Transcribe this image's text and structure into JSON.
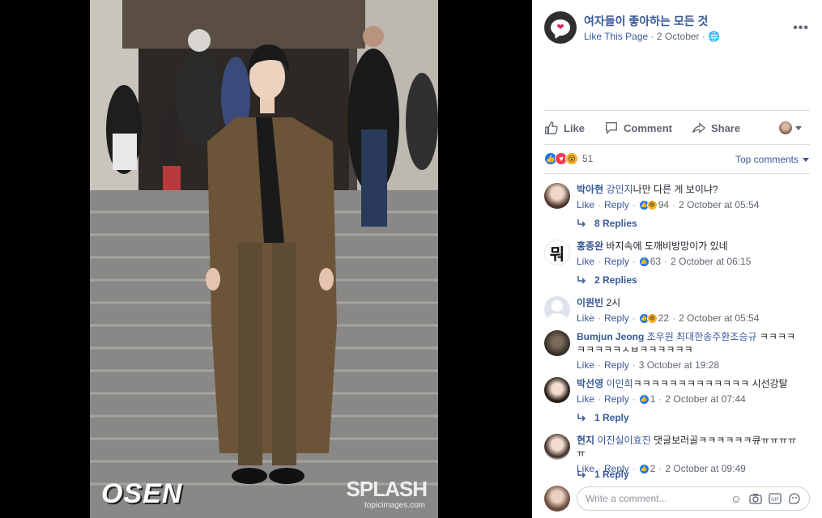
{
  "post": {
    "page_name": "여자들이 좋아하는 모든 것",
    "like_page": "Like This Page",
    "date": "2 October",
    "more": "•••"
  },
  "photo": {
    "watermark_left": "OSEN",
    "watermark_right": "SPLASH",
    "watermark_right_sub": "topicimages.com"
  },
  "actions": {
    "like": "Like",
    "comment": "Comment",
    "share": "Share"
  },
  "reactions": {
    "count": "51",
    "sort": "Top comments"
  },
  "comments": [
    {
      "name": "박아현",
      "mention": "강민지",
      "text": "나만 다른 게 보이냐?",
      "like": "Like",
      "reply": "Reply",
      "reaction_count": "94",
      "time": "2 October at 05:54",
      "replies": "8 Replies"
    },
    {
      "name": "홍종완",
      "mention": "",
      "text": "바지속에 도깨비방망이가 있네",
      "like": "Like",
      "reply": "Reply",
      "reaction_count": "63",
      "time": "2 October at 06:15",
      "replies": "2 Replies"
    },
    {
      "name": "이원빈",
      "mention": "",
      "text": "2시",
      "like": "Like",
      "reply": "Reply",
      "reaction_count": "22",
      "time": "2 October at 05:54",
      "replies": ""
    },
    {
      "name": "Bumjun Jeong",
      "mention": "조우원 최대한송주환조승규",
      "text": "ㅋㅋㅋㅋㅋㅋㅋㅋㅋㅅㅂㅋㅋㅋㅋㅋㅋ",
      "like": "Like",
      "reply": "Reply",
      "reaction_count": "",
      "time": "3 October at 19:28",
      "replies": ""
    },
    {
      "name": "박선영",
      "mention": "이민희",
      "text": "ㅋㅋㅋㅋㅋㅋㅋㅋㅋㅋㅋㅋㅋ 시선강탈",
      "like": "Like",
      "reply": "Reply",
      "reaction_count": "1",
      "time": "2 October at 07:44",
      "replies": "1 Reply"
    },
    {
      "name": "현지",
      "mention": "이진실이효진",
      "text": "댓글보러골ㅋㅋㅋㅋㅋㅋ큐ㅠㅠㅠㅠㅠ",
      "like": "Like",
      "reply": "Reply",
      "reaction_count": "2",
      "time": "2 October at 09:49",
      "replies": "1 Reply"
    }
  ],
  "composer": {
    "placeholder": "Write a comment..."
  }
}
